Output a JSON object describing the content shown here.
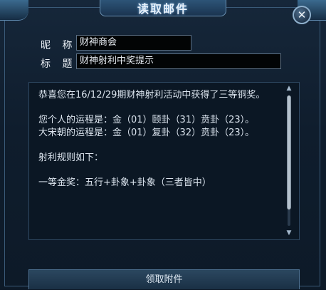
{
  "window": {
    "title": "读取邮件",
    "close_icon": "close-icon",
    "close_glyph": "✕"
  },
  "fields": {
    "nickname_label": "昵 称",
    "nickname_value": "财神商会",
    "subject_label": "标 题",
    "subject_value": "财神射利中奖提示"
  },
  "body": {
    "lines": [
      "恭喜您在16/12/29期财神射利活动中获得了三等铜奖。",
      "",
      "您个人的运程是：金（01）颐卦（31）贲卦（23）。",
      "大宋朝的运程是：金（01）复卦（32）贲卦（23）。",
      "",
      "射利规则如下：",
      "",
      "一等金奖：五行+卦象+卦象（三者皆中）"
    ]
  },
  "scrollbar": {
    "up_icon": "scroll-up-icon",
    "up_glyph": "▲",
    "down_icon": "scroll-down-icon",
    "down_glyph": "▼"
  },
  "footer": {
    "claim_label": "领取附件"
  }
}
